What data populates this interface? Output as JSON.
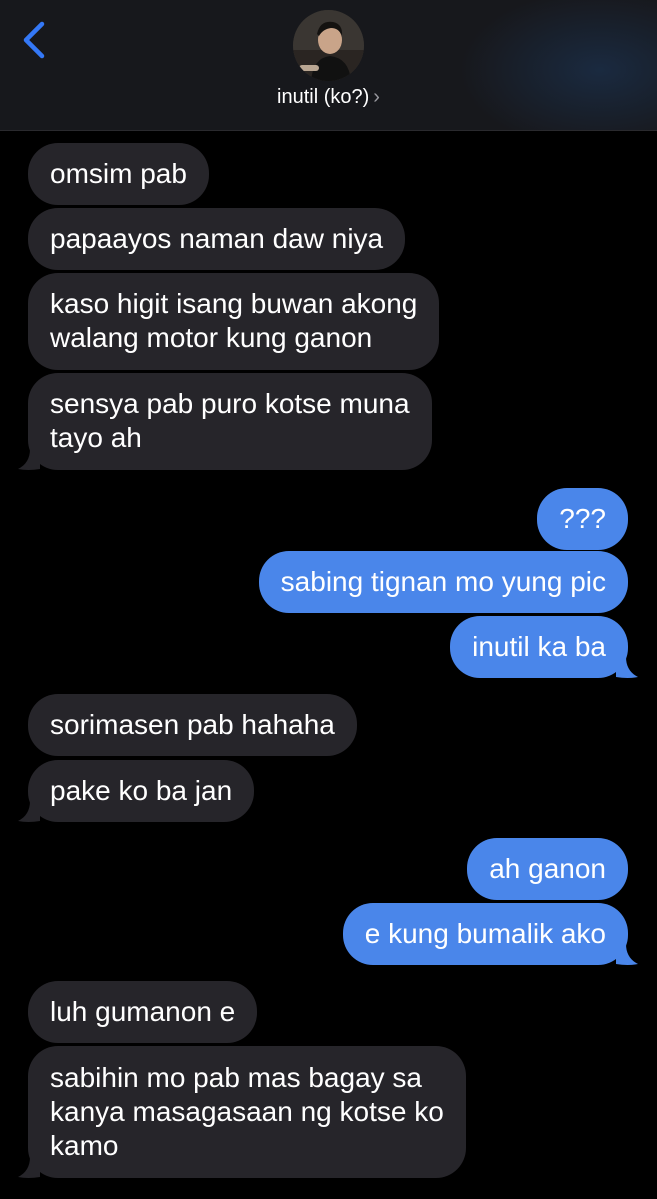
{
  "header": {
    "contact_name": "inutil (ko?)",
    "chevron": "›"
  },
  "messages": [
    {
      "side": "received",
      "text": "omsim pab"
    },
    {
      "side": "received",
      "text": "papaayos naman daw niya"
    },
    {
      "side": "received",
      "lines": [
        "kaso higit isang buwan akong",
        "walang motor kung ganon"
      ]
    },
    {
      "side": "received",
      "lines": [
        "sensya pab puro kotse muna",
        "tayo ah"
      ]
    },
    {
      "side": "sent",
      "text": "???"
    },
    {
      "side": "sent",
      "text": "sabing tignan mo yung pic"
    },
    {
      "side": "sent",
      "text": "inutil ka ba"
    },
    {
      "side": "received",
      "text": "sorimasen pab hahaha"
    },
    {
      "side": "received",
      "text": "pake ko ba jan"
    },
    {
      "side": "sent",
      "text": "ah ganon"
    },
    {
      "side": "sent",
      "text": "e kung bumalik ako"
    },
    {
      "side": "received",
      "text": "luh gumanon e"
    },
    {
      "side": "received",
      "lines": [
        "sabihin mo pab mas bagay sa",
        "kanya masagasaan ng kotse ko",
        "kamo"
      ]
    }
  ],
  "colors": {
    "sent_bubble": "#4a86ea",
    "received_bubble": "#26252a",
    "accent": "#3478f6"
  }
}
